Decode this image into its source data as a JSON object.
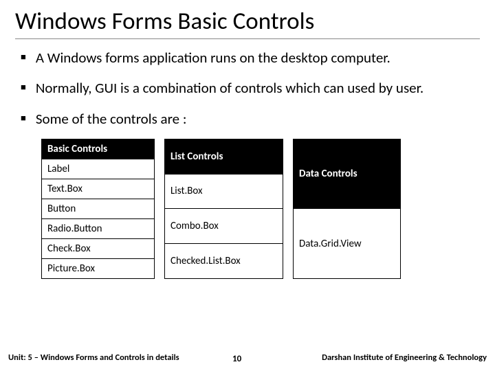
{
  "title": "Windows Forms Basic Controls",
  "bullets": [
    "A Windows forms application runs on the desktop computer.",
    "Normally, GUI is a combination of controls which can used by user.",
    "Some of the controls are :"
  ],
  "columns": {
    "basic": {
      "header": "Basic Controls",
      "items": [
        "Label",
        "Text.Box",
        "Button",
        "Radio.Button",
        "Check.Box",
        "Picture.Box"
      ]
    },
    "list": {
      "header": "List Controls",
      "items": [
        "List.Box",
        "Combo.Box",
        "Checked.List.Box"
      ]
    },
    "data": {
      "header": "Data Controls",
      "items": [
        "Data.Grid.View"
      ]
    }
  },
  "footer": {
    "unit": "Unit: 5 – Windows Forms and Controls in details",
    "page": "10",
    "institute": "Darshan Institute of Engineering & Technology"
  }
}
